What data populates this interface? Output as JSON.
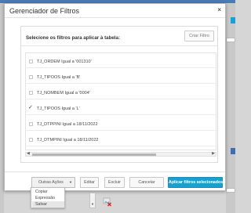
{
  "dialog": {
    "title": "Gerenciador de Filtros",
    "close_glyph": "×"
  },
  "panel": {
    "prompt": "Selecione os filtros para aplicar à tabela:",
    "clear_label": "Criar Filtro"
  },
  "filters": [
    {
      "label": "TJ_ORDEM Igual a '001310'",
      "checked": false
    },
    {
      "label": "TJ_TIPOOS Igual a 'B'",
      "checked": false
    },
    {
      "label": "TJ_NOMBEM Igual a '0004'",
      "checked": false
    },
    {
      "label": "TJ_TIPOOS Igual a 'L'",
      "checked": true
    },
    {
      "label": "TJ_DTPPINI Igual a 18/11/2022",
      "checked": false
    },
    {
      "label": "TJ_DTMPINI Igual a 18/11/2022",
      "checked": false
    }
  ],
  "footer": {
    "other_actions": "Outras Ações",
    "edit": "Editar",
    "delete": "Excluir",
    "cancel": "Cancelar",
    "apply": "Aplicar filtros selecionados"
  },
  "dropdown": {
    "items": [
      {
        "label": "Copiar",
        "active": false
      },
      {
        "label": "Expressão",
        "active": false
      },
      {
        "label": "Salvar",
        "active": true
      }
    ]
  },
  "colors": {
    "accent": "#1a9fce",
    "header_bar": "#4a7bb7"
  },
  "icons": [
    "close-icon",
    "checkmark-icon",
    "caret-down-icon",
    "scroll-left-icon",
    "scroll-right-icon",
    "image-delete-icon"
  ]
}
